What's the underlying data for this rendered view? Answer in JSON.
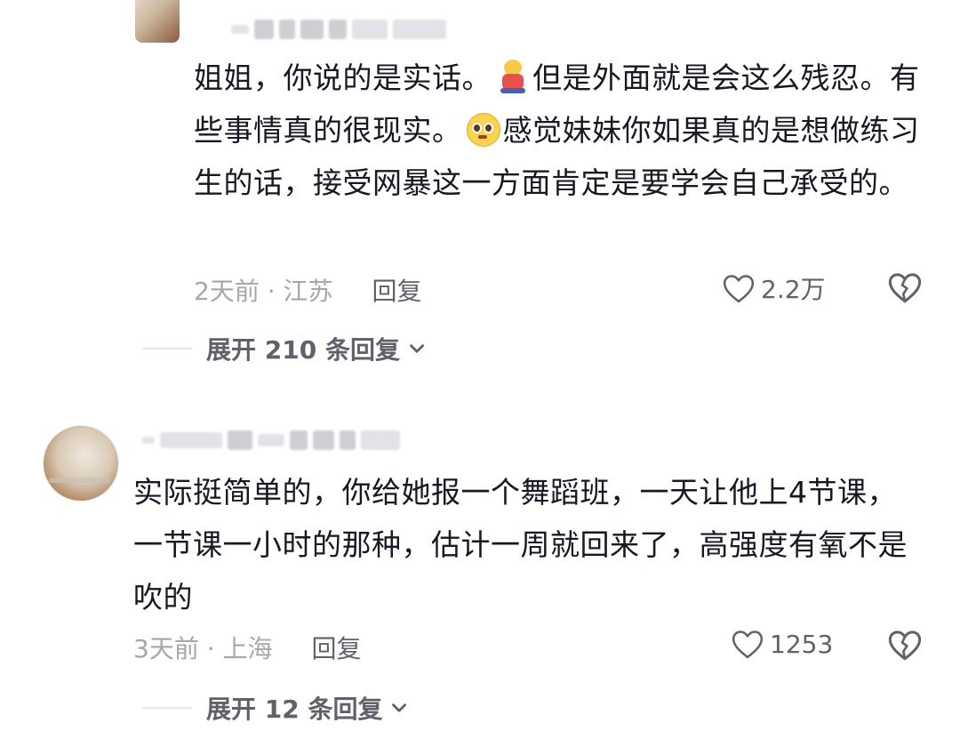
{
  "comments": [
    {
      "text_part1": "姐姐，你说的是实话。",
      "text_part2": "但是外面就是会这么残忍。有些事情真的很现实。",
      "text_part3": "感觉妹妹你如果真的是想做练习生的话，接受网暴这一方面肯定是要学会自己承受的。",
      "time_location": "2天前 · 江苏",
      "reply_label": "回复",
      "likes": "2.2万",
      "expand_label": "展开 210 条回复"
    },
    {
      "text": "实际挺简单的，你给她报一个舞蹈班，一天让他上4节课，一节课一小时的那种，估计一周就回来了，高强度有氧不是吹的",
      "time_location": "3天前 · 上海",
      "reply_label": "回复",
      "likes": "1253",
      "expand_label": "展开 12 条回复"
    }
  ],
  "icons": {
    "like": "heart-outline-icon",
    "dislike": "broken-heart-icon",
    "expand": "chevron-down-icon",
    "emoji1": "bear-emoji-icon",
    "emoji2": "pleading-face-emoji-icon"
  },
  "colors": {
    "text": "#161823",
    "meta": "#a6a7ab",
    "action": "#60616a"
  }
}
